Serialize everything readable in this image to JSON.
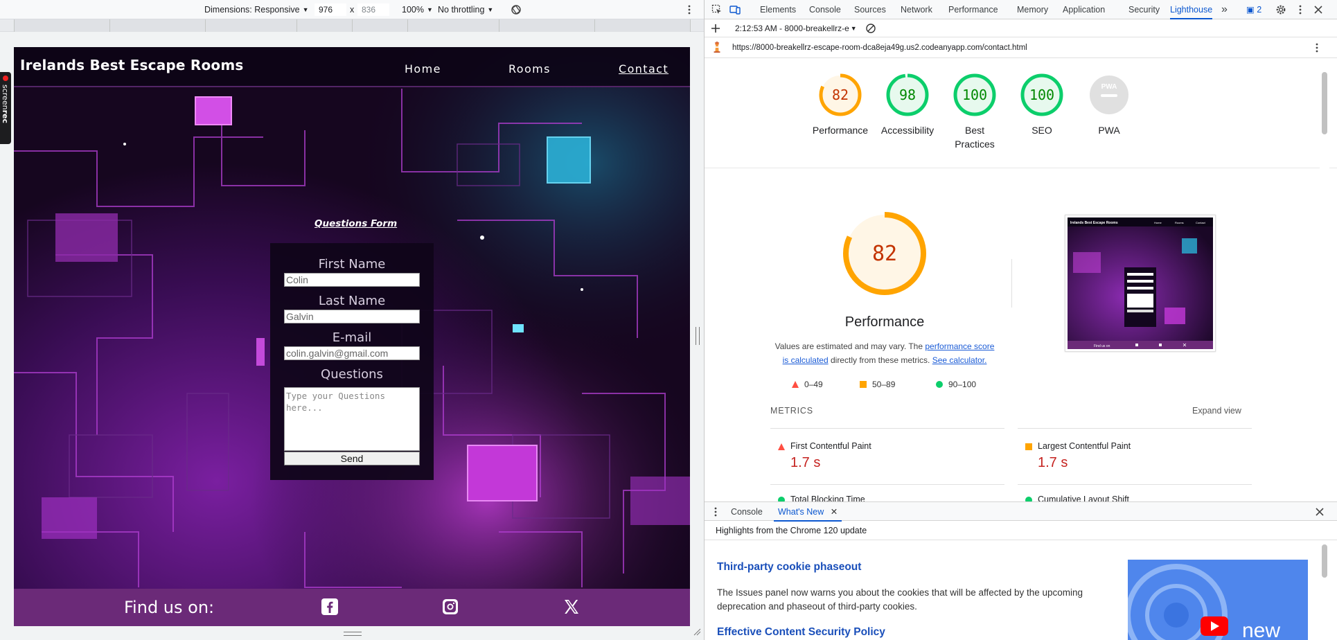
{
  "device_toolbar": {
    "dimensions_label": "Dimensions: Responsive",
    "width_value": "976",
    "separator": "x",
    "height_value": "836",
    "zoom": "100%",
    "throttling": "No throttling"
  },
  "site": {
    "brand": "Irelands Best Escape Rooms",
    "nav": [
      "Home",
      "Rooms",
      "Contact"
    ],
    "form_title": "Questions Form",
    "fields": {
      "first_name_label": "First Name",
      "first_name_value": "Colin",
      "last_name_label": "Last Name",
      "last_name_value": "Galvin",
      "email_label": "E-mail",
      "email_value": "colin.galvin@gmail.com",
      "questions_label": "Questions",
      "questions_placeholder": "Type your Questions here..."
    },
    "send_label": "Send",
    "footer_text": "Find us on:"
  },
  "screenrec": {
    "prefix": "screen",
    "suffix": "rec"
  },
  "devtools": {
    "tabs": [
      "Elements",
      "Console",
      "Sources",
      "Network",
      "Performance",
      "Memory",
      "Application",
      "Security",
      "Lighthouse"
    ],
    "more_tabs": "»",
    "issues_count": "2",
    "report_label": "2:12:53 AM - 8000-breakellrz-e",
    "url": "https://8000-breakellrz-escape-room-dca8eja49g.us2.codeanyapp.com/contact.html"
  },
  "lighthouse": {
    "scores": [
      {
        "label": "Performance",
        "value": "82",
        "score": 0.82,
        "status": "average"
      },
      {
        "label": "Accessibility",
        "value": "98",
        "score": 0.98,
        "status": "pass"
      },
      {
        "label": "Best Practices",
        "value": "100",
        "score": 1.0,
        "status": "pass"
      },
      {
        "label": "SEO",
        "value": "100",
        "score": 1.0,
        "status": "pass"
      },
      {
        "label": "PWA",
        "value": "PWA",
        "score": 0,
        "status": "na"
      }
    ],
    "performance_title": "Performance",
    "performance_score": "82",
    "note_part1": "Values are estimated and may vary. The ",
    "note_link1": "performance score is calculated",
    "note_part2": " directly from these metrics. ",
    "note_link2": "See calculator.",
    "legend": [
      "0–49",
      "50–89",
      "90–100"
    ],
    "thumb": {
      "brand": "Irelands Best Escape Rooms",
      "nav": [
        "Home",
        "Rooms",
        "Contact"
      ],
      "footer_text": "Find us on"
    },
    "metrics_heading": "METRICS",
    "expand_label": "Expand view",
    "metrics": [
      {
        "name": "First Contentful Paint",
        "value": "1.7 s",
        "status": "fail"
      },
      {
        "name": "Largest Contentful Paint",
        "value": "1.7 s",
        "status": "average"
      },
      {
        "name": "Total Blocking Time",
        "status": "pass"
      },
      {
        "name": "Cumulative Layout Shift",
        "status": "pass"
      }
    ]
  },
  "drawer": {
    "tabs": [
      "Console",
      "What's New"
    ],
    "subtitle": "Highlights from the Chrome 120 update",
    "items": [
      {
        "title": "Third-party cookie phaseout",
        "body": "The Issues panel now warns you about the cookies that will be affected by the upcoming deprecation and phaseout of third-party cookies."
      },
      {
        "title": "Effective Content Security Policy",
        "body": ""
      }
    ],
    "video_word": "new"
  },
  "colors": {
    "accent": "#0b57d0",
    "pass": "#0cce6b",
    "average": "#ffa400",
    "fail": "#ff4e42",
    "footer": "#6b2a78"
  }
}
